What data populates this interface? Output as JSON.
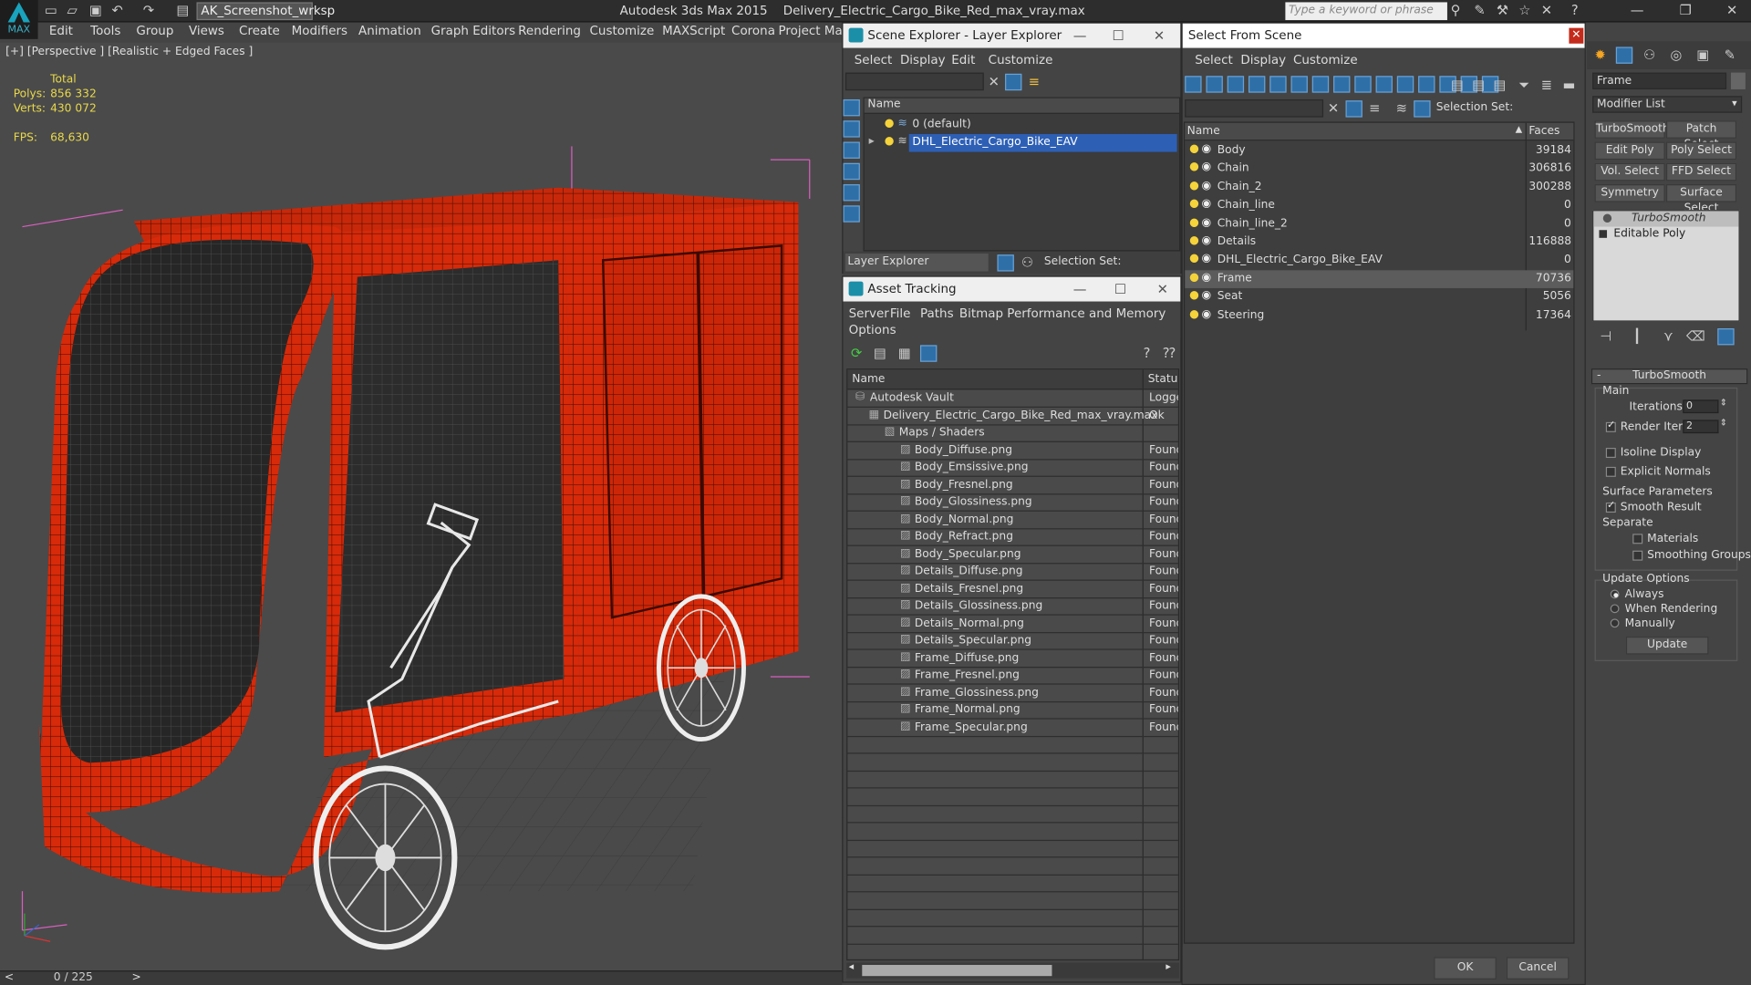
{
  "app": {
    "title": "Autodesk 3ds Max  2015",
    "file": "Delivery_Electric_Cargo_Bike_Red_max_vray.max",
    "logo_text": "MAX",
    "workspace": "AK_Screenshot_wrksp",
    "search_placeholder": "Type a keyword or phrase"
  },
  "menubar": [
    "Edit",
    "Tools",
    "Group",
    "Views",
    "Create",
    "Modifiers",
    "Animation",
    "Graph Editors",
    "Rendering",
    "Customize",
    "MAXScript",
    "Corona",
    "Project Man"
  ],
  "viewport": {
    "label": "[+] [Perspective ] [Realistic + Edged Faces ]",
    "stats_header": "Total",
    "polys_label": "Polys:",
    "polys": "856 332",
    "verts_label": "Verts:",
    "verts": "430 072",
    "fps_label": "FPS:",
    "fps": "68,630"
  },
  "timebar": {
    "frames": "0 / 225",
    "prev": "<",
    "next": ">"
  },
  "scene_explorer": {
    "title": "Scene Explorer - Layer Explorer",
    "menu": [
      "Select",
      "Display",
      "Edit",
      "Customize"
    ],
    "col_name": "Name",
    "layers": [
      {
        "name": "0 (default)",
        "selected": false
      },
      {
        "name": "DHL_Electric_Cargo_Bike_EAV",
        "selected": true
      }
    ],
    "footer_label": "Layer Explorer",
    "selection_set": "Selection Set:"
  },
  "asset_tracking": {
    "title": "Asset Tracking",
    "menu": [
      "Server",
      "File",
      "Paths",
      "Bitmap Performance and Memory"
    ],
    "menu2": "Options",
    "col_name": "Name",
    "col_status": "Status",
    "rows": [
      {
        "name": "Autodesk Vault",
        "status": "Logge",
        "indent": 0
      },
      {
        "name": "Delivery_Electric_Cargo_Bike_Red_max_vray.max",
        "status": "Ok",
        "indent": 1
      },
      {
        "name": "Maps / Shaders",
        "status": "",
        "indent": 2
      },
      {
        "name": "Body_Diffuse.png",
        "status": "Found",
        "indent": 3
      },
      {
        "name": "Body_Emsissive.png",
        "status": "Found",
        "indent": 3
      },
      {
        "name": "Body_Fresnel.png",
        "status": "Found",
        "indent": 3
      },
      {
        "name": "Body_Glossiness.png",
        "status": "Found",
        "indent": 3
      },
      {
        "name": "Body_Normal.png",
        "status": "Found",
        "indent": 3
      },
      {
        "name": "Body_Refract.png",
        "status": "Found",
        "indent": 3
      },
      {
        "name": "Body_Specular.png",
        "status": "Found",
        "indent": 3
      },
      {
        "name": "Details_Diffuse.png",
        "status": "Found",
        "indent": 3
      },
      {
        "name": "Details_Fresnel.png",
        "status": "Found",
        "indent": 3
      },
      {
        "name": "Details_Glossiness.png",
        "status": "Found",
        "indent": 3
      },
      {
        "name": "Details_Normal.png",
        "status": "Found",
        "indent": 3
      },
      {
        "name": "Details_Specular.png",
        "status": "Found",
        "indent": 3
      },
      {
        "name": "Frame_Diffuse.png",
        "status": "Found",
        "indent": 3
      },
      {
        "name": "Frame_Fresnel.png",
        "status": "Found",
        "indent": 3
      },
      {
        "name": "Frame_Glossiness.png",
        "status": "Found",
        "indent": 3
      },
      {
        "name": "Frame_Normal.png",
        "status": "Found",
        "indent": 3
      },
      {
        "name": "Frame_Specular.png",
        "status": "Found",
        "indent": 3
      }
    ]
  },
  "select_from_scene": {
    "title": "Select From Scene",
    "menu": [
      "Select",
      "Display",
      "Customize"
    ],
    "selection_set": "Selection Set:",
    "col_name": "Name",
    "col_faces": "Faces",
    "rows": [
      {
        "name": "Body",
        "faces": "39184",
        "selected": false
      },
      {
        "name": "Chain",
        "faces": "306816",
        "selected": false
      },
      {
        "name": "Chain_2",
        "faces": "300288",
        "selected": false
      },
      {
        "name": "Chain_line",
        "faces": "0",
        "selected": false
      },
      {
        "name": "Chain_line_2",
        "faces": "0",
        "selected": false
      },
      {
        "name": "Details",
        "faces": "116888",
        "selected": false
      },
      {
        "name": "DHL_Electric_Cargo_Bike_EAV",
        "faces": "0",
        "selected": false
      },
      {
        "name": "Frame",
        "faces": "70736",
        "selected": true
      },
      {
        "name": "Seat",
        "faces": "5056",
        "selected": false
      },
      {
        "name": "Steering",
        "faces": "17364",
        "selected": false
      }
    ],
    "ok": "OK",
    "cancel": "Cancel"
  },
  "command_panel": {
    "object_name": "Frame",
    "modifier_list": "Modifier List",
    "mod_buttons": [
      "TurboSmooth",
      "Patch Select",
      "Edit Poly",
      "Poly Select",
      "Vol. Select",
      "FFD Select",
      "Symmetry",
      "Surface Select"
    ],
    "stack": [
      "TurboSmooth",
      "Editable Poly"
    ],
    "rollout_title": "TurboSmooth",
    "main": "Main",
    "iterations_label": "Iterations:",
    "iterations": "0",
    "render_iters_label": "Render Iters:",
    "render_iters": "2",
    "isoline": "Isoline Display",
    "explicit": "Explicit Normals",
    "surface_params": "Surface Parameters",
    "smooth_result": "Smooth Result",
    "separate": "Separate",
    "materials": "Materials",
    "smoothing_groups": "Smoothing Groups",
    "update_options": "Update Options",
    "always": "Always",
    "when_rendering": "When Rendering",
    "manually": "Manually",
    "update": "Update"
  },
  "colors": {
    "bike_red": "#d62a0a",
    "selection": "#2d5fb5",
    "titlebar": "#2d2d2d"
  }
}
